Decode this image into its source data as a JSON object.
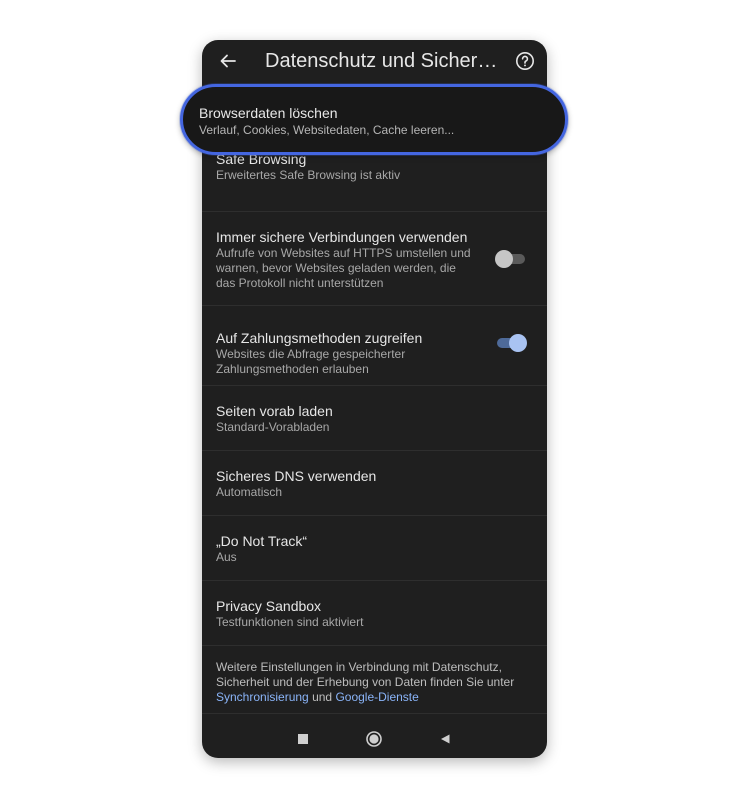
{
  "appbar": {
    "title": "Datenschutz und Sicherh...",
    "back_icon": "arrow-left-icon",
    "help_icon": "help-circle-icon"
  },
  "clear_data": {
    "title": "Browserdaten löschen",
    "subtitle": "Verlauf, Cookies, Websitedaten, Cache leeren..."
  },
  "safe_browsing": {
    "title": "Safe Browsing",
    "subtitle": "Erweitertes Safe Browsing ist aktiv"
  },
  "https": {
    "title": "Immer sichere Verbindungen verwenden",
    "subtitle": "Aufrufe von Websites auf HTTPS umstellen und warnen, bevor Websites geladen werden, die das Protokoll nicht unterstützen",
    "enabled": false
  },
  "payment": {
    "title": "Auf Zahlungsmethoden zugreifen",
    "subtitle": "Websites die Abfrage gespeicherter Zahlungsmethoden erlauben",
    "enabled": true
  },
  "preload": {
    "title": "Seiten vorab laden",
    "subtitle": "Standard-Vorabladen"
  },
  "dns": {
    "title": "Sicheres DNS verwenden",
    "subtitle": "Automatisch"
  },
  "dnt": {
    "title": "„Do Not Track“",
    "subtitle": "Aus"
  },
  "sandbox": {
    "title": "Privacy Sandbox",
    "subtitle": "Testfunktionen sind aktiviert"
  },
  "footer": {
    "text": "Weitere Einstellungen in Verbindung mit Datenschutz, Sicherheit und der Erhebung von Daten finden Sie unter",
    "link_sync": "Synchronisierung",
    "conjunction": "und",
    "link_google": "Google-Dienste"
  },
  "navbar": {
    "recents_icon": "square-icon",
    "home_icon": "circle-icon",
    "back_icon": "triangle-back-icon"
  },
  "colors": {
    "background": "#1f1f1f",
    "highlight_border": "#4466e0",
    "link": "#8ab4f8",
    "toggle_on_knob": "#a9c3f2",
    "toggle_off_knob": "#c6c6c6"
  }
}
